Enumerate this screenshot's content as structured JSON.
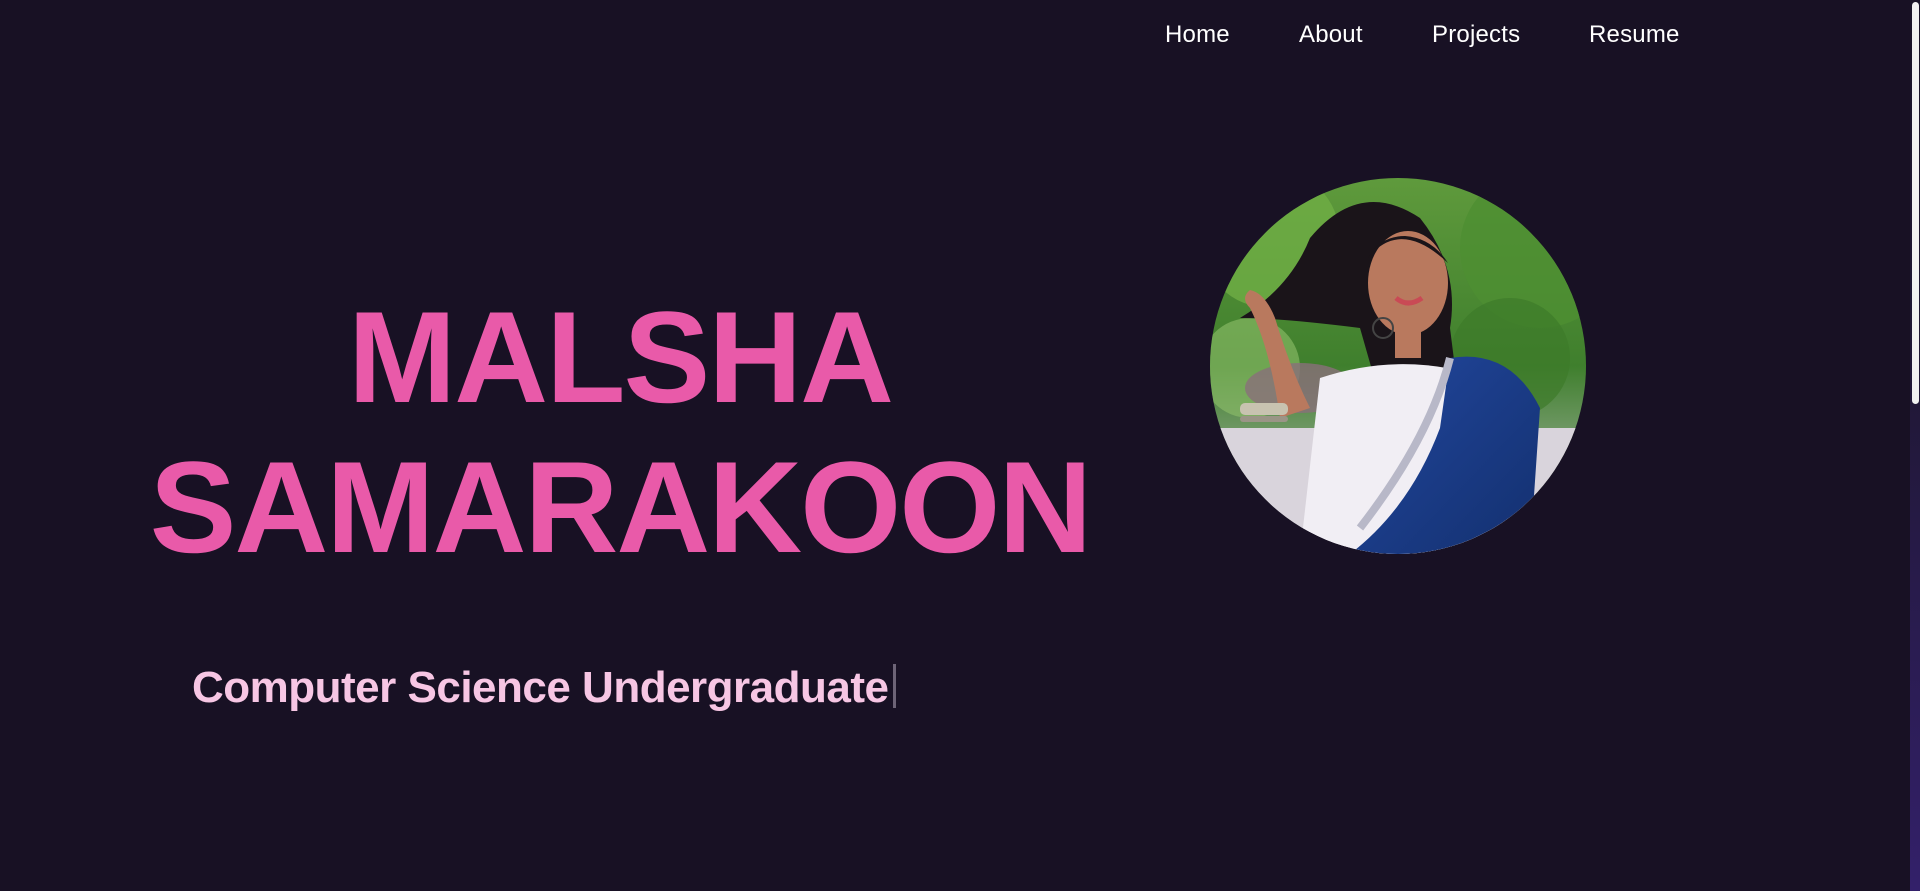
{
  "nav": {
    "items": [
      {
        "label": "Home"
      },
      {
        "label": "About"
      },
      {
        "label": "Projects"
      },
      {
        "label": "Resume"
      }
    ]
  },
  "hero": {
    "first_name": "MALSHA",
    "last_name": "SAMARAKOON",
    "subtitle": "Computer Science Undergraduate"
  },
  "colors": {
    "background": "#181124",
    "name_accent": "#e95aa9",
    "subtitle": "#f7c6e4",
    "nav_text": "#ffffff"
  },
  "icons": {
    "avatar": "profile-photo"
  }
}
